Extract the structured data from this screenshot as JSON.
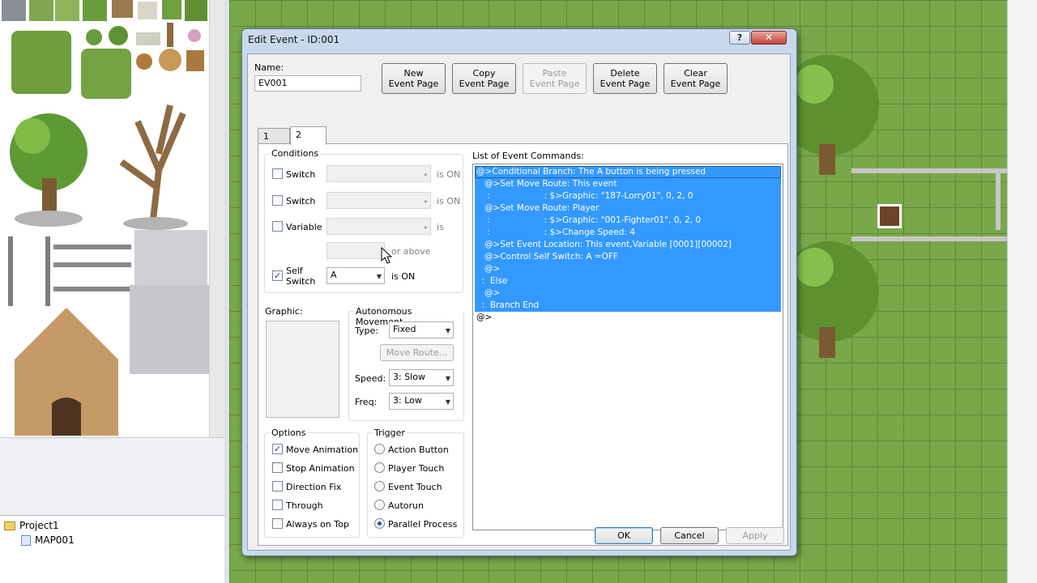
{
  "dialog": {
    "title": "Edit Event - ID:001",
    "help_button": "?",
    "close_button": "✕"
  },
  "name_section": {
    "label": "Name:",
    "value": "EV001"
  },
  "toolbar": {
    "new_page": [
      "New",
      "Event Page"
    ],
    "copy_page": [
      "Copy",
      "Event Page"
    ],
    "paste_page": [
      "Paste",
      "Event Page"
    ],
    "delete_page": [
      "Delete",
      "Event Page"
    ],
    "clear_page": [
      "Clear",
      "Event Page"
    ]
  },
  "tabs": [
    "1",
    "2"
  ],
  "conditions": {
    "title": "Conditions",
    "switch1": {
      "label": "Switch",
      "suffix": "is ON",
      "checked": false
    },
    "switch2": {
      "label": "Switch",
      "suffix": "is ON",
      "checked": false
    },
    "variable": {
      "label": "Variable",
      "suffix": "is",
      "or_above": "or above",
      "checked": false
    },
    "self_switch": {
      "label_line1": "Self",
      "label_line2": "Switch",
      "value": "A",
      "suffix": "is ON",
      "checked": true
    }
  },
  "graphic": {
    "label": "Graphic:"
  },
  "autonomous": {
    "title": "Autonomous Movement",
    "type_label": "Type:",
    "type_value": "Fixed",
    "move_route": "Move Route...",
    "speed_label": "Speed:",
    "speed_value": "3: Slow",
    "freq_label": "Freq:",
    "freq_value": "3: Low"
  },
  "options": {
    "title": "Options",
    "items": [
      {
        "label": "Move Animation",
        "checked": true
      },
      {
        "label": "Stop Animation",
        "checked": false
      },
      {
        "label": "Direction Fix",
        "checked": false
      },
      {
        "label": "Through",
        "checked": false
      },
      {
        "label": "Always on Top",
        "checked": false
      }
    ]
  },
  "trigger": {
    "title": "Trigger",
    "items": [
      {
        "label": "Action Button",
        "selected": false
      },
      {
        "label": "Player Touch",
        "selected": false
      },
      {
        "label": "Event Touch",
        "selected": false
      },
      {
        "label": "Autorun",
        "selected": false
      },
      {
        "label": "Parallel Process",
        "selected": true
      }
    ]
  },
  "commands": {
    "title": "List of Event Commands:",
    "lines": [
      {
        "text": "@>Conditional Branch: The A button is being pressed",
        "selected": true
      },
      {
        "text": "   @>Set Move Route: This event",
        "selected": true
      },
      {
        "text": "    :                    : $>Graphic: \"187-Lorry01\", 0, 2, 0",
        "selected": true
      },
      {
        "text": "   @>Set Move Route: Player",
        "selected": true
      },
      {
        "text": "    :                    : $>Graphic: \"001-Fighter01\", 0, 2, 0",
        "selected": true
      },
      {
        "text": "    :                    : $>Change Speed: 4",
        "selected": true
      },
      {
        "text": "   @>Set Event Location: This event,Variable [0001][00002]",
        "selected": true
      },
      {
        "text": "   @>Control Self Switch: A =OFF",
        "selected": true
      },
      {
        "text": "   @>",
        "selected": true
      },
      {
        "text": "  :  Else",
        "selected": true
      },
      {
        "text": "   @>",
        "selected": true
      },
      {
        "text": "  :  Branch End",
        "selected": true
      },
      {
        "text": "@>",
        "selected": false
      }
    ]
  },
  "footer": {
    "ok": "OK",
    "cancel": "Cancel",
    "apply": "Apply"
  },
  "project_tree": {
    "project": "Project1",
    "map": "MAP001"
  }
}
